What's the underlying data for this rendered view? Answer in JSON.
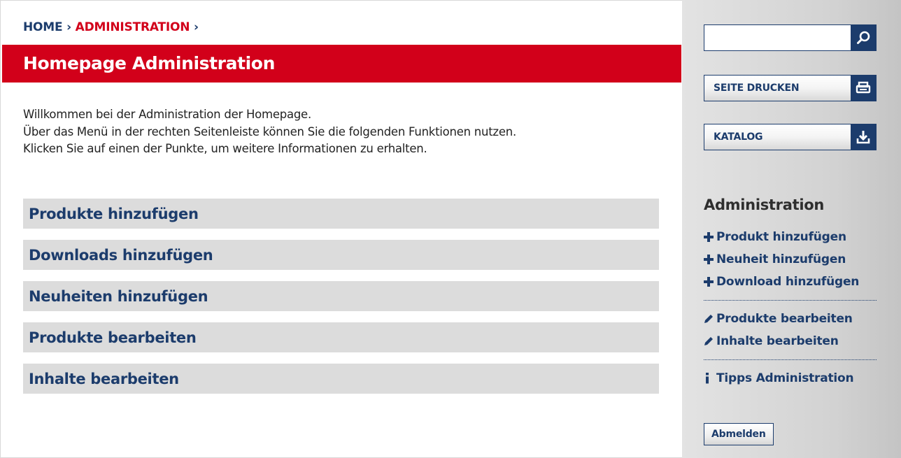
{
  "breadcrumb": {
    "home": "HOME",
    "separator": "›",
    "current": "ADMINISTRATION"
  },
  "page": {
    "title": "Homepage Administration",
    "intro": [
      "Willkommen bei der Administration der Homepage.",
      "Über das Menü in der rechten Seitenleiste können Sie die folgenden Funktionen nutzen.",
      "Klicken Sie auf einen der Punkte, um weitere Informationen zu erhalten."
    ],
    "menu": [
      "Produkte hinzufügen",
      "Downloads hinzufügen",
      "Neuheiten hinzufügen",
      "Produkte bearbeiten",
      "Inhalte bearbeiten"
    ]
  },
  "sidebar": {
    "search": {
      "value": "",
      "icon": "search-icon"
    },
    "print_button": {
      "label": "SEITE DRUCKEN",
      "icon": "printer-icon"
    },
    "catalog_button": {
      "label": "KATALOG",
      "icon": "download-icon"
    },
    "heading": "Administration",
    "add_links": [
      {
        "label": "Produkt hinzufügen",
        "icon": "plus-icon"
      },
      {
        "label": "Neuheit hinzufügen",
        "icon": "plus-icon"
      },
      {
        "label": "Download hinzufügen",
        "icon": "plus-icon"
      }
    ],
    "edit_links": [
      {
        "label": "Produkte bearbeiten",
        "icon": "pencil-icon"
      },
      {
        "label": "Inhalte bearbeiten",
        "icon": "pencil-icon"
      }
    ],
    "tips_link": {
      "label": "Tipps Administration",
      "icon": "info-icon"
    },
    "logout_label": "Abmelden"
  },
  "colors": {
    "brand_red": "#d2001a",
    "brand_blue": "#1c3c6c",
    "menu_bg": "#dcdcdc"
  }
}
